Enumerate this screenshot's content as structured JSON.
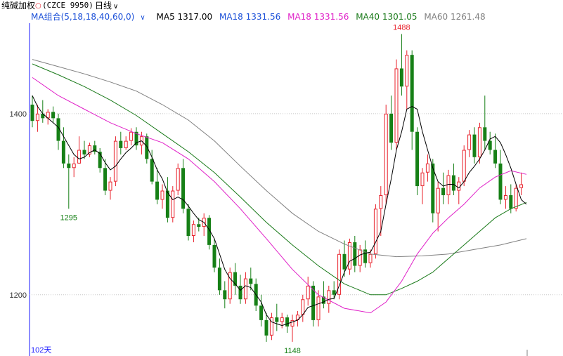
{
  "header": {
    "instrument": "纯碱加权",
    "code": "(CZCE 9950)",
    "period": "日线"
  },
  "ma_bar": {
    "group_label": "MA组合(5,18,18,40,60,0)",
    "ma5": "MA5 1317.00",
    "ma18a": "MA18 1331.56",
    "ma18b": "MA18 1331.56",
    "ma40": "MA40 1301.05",
    "ma60": "MA60 1261.48"
  },
  "colors": {
    "up": "#e8202a",
    "down": "#168016",
    "ma5": "#000000",
    "ma18": "#e020c8",
    "ma40": "#1a7a1a",
    "ma60": "#808080",
    "grid": "#c8c8c8",
    "axis": "#1a1aff"
  },
  "footer": {
    "days": "102天"
  },
  "chart_data": {
    "type": "candlestick",
    "y_ticks": [
      1400,
      1200
    ],
    "ylim": [
      1144,
      1500
    ],
    "annotations": [
      {
        "label": "1488",
        "index": 71,
        "value": 1488,
        "color": "up"
      },
      {
        "label": "1295",
        "index": 7,
        "value": 1295,
        "color": "down"
      },
      {
        "label": "1148",
        "index": 50,
        "value": 1148,
        "color": "down"
      }
    ],
    "candles": [
      [
        1410,
        1420,
        1385,
        1392
      ],
      [
        1392,
        1410,
        1380,
        1400
      ],
      [
        1400,
        1415,
        1390,
        1395
      ],
      [
        1395,
        1405,
        1388,
        1402
      ],
      [
        1402,
        1408,
        1390,
        1395
      ],
      [
        1395,
        1400,
        1360,
        1370
      ],
      [
        1370,
        1385,
        1340,
        1345
      ],
      [
        1345,
        1355,
        1295,
        1340
      ],
      [
        1340,
        1352,
        1330,
        1345
      ],
      [
        1345,
        1375,
        1345,
        1360
      ],
      [
        1360,
        1370,
        1350,
        1355
      ],
      [
        1355,
        1368,
        1352,
        1365
      ],
      [
        1365,
        1370,
        1355,
        1358
      ],
      [
        1358,
        1362,
        1335,
        1340
      ],
      [
        1340,
        1350,
        1310,
        1315
      ],
      [
        1315,
        1330,
        1305,
        1325
      ],
      [
        1325,
        1375,
        1320,
        1370
      ],
      [
        1370,
        1380,
        1355,
        1362
      ],
      [
        1362,
        1375,
        1360,
        1370
      ],
      [
        1370,
        1384,
        1365,
        1380
      ],
      [
        1380,
        1385,
        1360,
        1365
      ],
      [
        1365,
        1380,
        1355,
        1375
      ],
      [
        1375,
        1378,
        1345,
        1350
      ],
      [
        1350,
        1360,
        1322,
        1325
      ],
      [
        1325,
        1340,
        1300,
        1305
      ],
      [
        1305,
        1322,
        1295,
        1315
      ],
      [
        1315,
        1330,
        1280,
        1285
      ],
      [
        1285,
        1320,
        1280,
        1315
      ],
      [
        1315,
        1345,
        1310,
        1340
      ],
      [
        1340,
        1350,
        1290,
        1295
      ],
      [
        1295,
        1300,
        1260,
        1265
      ],
      [
        1265,
        1282,
        1258,
        1278
      ],
      [
        1278,
        1285,
        1270,
        1275
      ],
      [
        1275,
        1290,
        1265,
        1285
      ],
      [
        1285,
        1288,
        1250,
        1255
      ],
      [
        1255,
        1262,
        1225,
        1230
      ],
      [
        1230,
        1240,
        1200,
        1205
      ],
      [
        1205,
        1215,
        1185,
        1195
      ],
      [
        1195,
        1230,
        1190,
        1225
      ],
      [
        1225,
        1235,
        1200,
        1210
      ],
      [
        1210,
        1222,
        1190,
        1195
      ],
      [
        1195,
        1225,
        1190,
        1218
      ],
      [
        1218,
        1230,
        1205,
        1212
      ],
      [
        1212,
        1218,
        1182,
        1188
      ],
      [
        1188,
        1200,
        1165,
        1172
      ],
      [
        1172,
        1180,
        1148,
        1155
      ],
      [
        1155,
        1180,
        1150,
        1175
      ],
      [
        1175,
        1190,
        1160,
        1170
      ],
      [
        1170,
        1180,
        1163,
        1175
      ],
      [
        1175,
        1178,
        1158,
        1165
      ],
      [
        1165,
        1178,
        1148,
        1172
      ],
      [
        1172,
        1182,
        1165,
        1178
      ],
      [
        1178,
        1200,
        1170,
        1195
      ],
      [
        1195,
        1220,
        1188,
        1210
      ],
      [
        1210,
        1215,
        1165,
        1172
      ],
      [
        1172,
        1205,
        1165,
        1198
      ],
      [
        1198,
        1215,
        1185,
        1190
      ],
      [
        1190,
        1210,
        1180,
        1205
      ],
      [
        1205,
        1215,
        1195,
        1200
      ],
      [
        1200,
        1250,
        1195,
        1245
      ],
      [
        1245,
        1260,
        1220,
        1228
      ],
      [
        1228,
        1262,
        1222,
        1258
      ],
      [
        1258,
        1265,
        1225,
        1232
      ],
      [
        1232,
        1255,
        1225,
        1250
      ],
      [
        1250,
        1260,
        1230,
        1235
      ],
      [
        1235,
        1250,
        1230,
        1245
      ],
      [
        1245,
        1300,
        1240,
        1295
      ],
      [
        1295,
        1320,
        1265,
        1310
      ],
      [
        1310,
        1410,
        1300,
        1400
      ],
      [
        1400,
        1420,
        1360,
        1368
      ],
      [
        1368,
        1460,
        1360,
        1450
      ],
      [
        1450,
        1488,
        1420,
        1430
      ],
      [
        1430,
        1470,
        1405,
        1465
      ],
      [
        1465,
        1470,
        1360,
        1380
      ],
      [
        1380,
        1385,
        1310,
        1320
      ],
      [
        1320,
        1340,
        1300,
        1335
      ],
      [
        1335,
        1355,
        1325,
        1345
      ],
      [
        1345,
        1350,
        1280,
        1290
      ],
      [
        1290,
        1325,
        1270,
        1318
      ],
      [
        1318,
        1335,
        1300,
        1310
      ],
      [
        1310,
        1338,
        1300,
        1332
      ],
      [
        1332,
        1345,
        1310,
        1315
      ],
      [
        1315,
        1330,
        1300,
        1325
      ],
      [
        1325,
        1365,
        1320,
        1360
      ],
      [
        1360,
        1382,
        1352,
        1377
      ],
      [
        1377,
        1385,
        1345,
        1352
      ],
      [
        1352,
        1390,
        1345,
        1385
      ],
      [
        1385,
        1420,
        1360,
        1370
      ],
      [
        1370,
        1380,
        1355,
        1360
      ],
      [
        1360,
        1378,
        1340,
        1345
      ],
      [
        1345,
        1360,
        1300,
        1305
      ],
      [
        1305,
        1320,
        1295,
        1310
      ],
      [
        1310,
        1322,
        1290,
        1295
      ],
      [
        1295,
        1322,
        1292,
        1318
      ],
      [
        1318,
        1335,
        1310,
        1322
      ]
    ],
    "ma5": [
      [
        0,
        1420
      ],
      [
        1,
        1408
      ],
      [
        2,
        1400
      ],
      [
        3,
        1395
      ],
      [
        4,
        1390
      ],
      [
        5,
        1385
      ],
      [
        6,
        1375
      ],
      [
        7,
        1365
      ],
      [
        8,
        1355
      ],
      [
        9,
        1350
      ],
      [
        10,
        1352
      ],
      [
        11,
        1357
      ],
      [
        12,
        1360
      ],
      [
        13,
        1356
      ],
      [
        14,
        1346
      ],
      [
        15,
        1338
      ],
      [
        16,
        1342
      ],
      [
        17,
        1350
      ],
      [
        18,
        1357
      ],
      [
        19,
        1362
      ],
      [
        20,
        1368
      ],
      [
        21,
        1370
      ],
      [
        22,
        1364
      ],
      [
        23,
        1352
      ],
      [
        24,
        1338
      ],
      [
        25,
        1328
      ],
      [
        26,
        1313
      ],
      [
        27,
        1305
      ],
      [
        28,
        1308
      ],
      [
        29,
        1305
      ],
      [
        30,
        1298
      ],
      [
        31,
        1290
      ],
      [
        32,
        1283
      ],
      [
        33,
        1280
      ],
      [
        34,
        1272
      ],
      [
        35,
        1262
      ],
      [
        36,
        1245
      ],
      [
        37,
        1228
      ],
      [
        38,
        1218
      ],
      [
        39,
        1212
      ],
      [
        40,
        1205
      ],
      [
        41,
        1210
      ],
      [
        42,
        1208
      ],
      [
        43,
        1200
      ],
      [
        44,
        1192
      ],
      [
        45,
        1178
      ],
      [
        46,
        1170
      ],
      [
        47,
        1168
      ],
      [
        48,
        1166
      ],
      [
        49,
        1168
      ],
      [
        50,
        1170
      ],
      [
        51,
        1172
      ],
      [
        52,
        1178
      ],
      [
        53,
        1186
      ],
      [
        54,
        1188
      ],
      [
        55,
        1190
      ],
      [
        56,
        1192
      ],
      [
        57,
        1195
      ],
      [
        58,
        1196
      ],
      [
        59,
        1210
      ],
      [
        60,
        1225
      ],
      [
        61,
        1237
      ],
      [
        62,
        1240
      ],
      [
        63,
        1244
      ],
      [
        64,
        1246
      ],
      [
        65,
        1247
      ],
      [
        66,
        1258
      ],
      [
        67,
        1270
      ],
      [
        68,
        1300
      ],
      [
        69,
        1328
      ],
      [
        70,
        1360
      ],
      [
        71,
        1380
      ],
      [
        72,
        1405
      ],
      [
        73,
        1408
      ],
      [
        74,
        1405
      ],
      [
        75,
        1380
      ],
      [
        76,
        1360
      ],
      [
        77,
        1340
      ],
      [
        78,
        1325
      ],
      [
        79,
        1320
      ],
      [
        80,
        1322
      ],
      [
        81,
        1322
      ],
      [
        82,
        1318
      ],
      [
        83,
        1325
      ],
      [
        84,
        1335
      ],
      [
        85,
        1342
      ],
      [
        86,
        1350
      ],
      [
        87,
        1360
      ],
      [
        88,
        1372
      ],
      [
        89,
        1375
      ],
      [
        90,
        1368
      ],
      [
        91,
        1355
      ],
      [
        92,
        1340
      ],
      [
        93,
        1322
      ],
      [
        94,
        1305
      ],
      [
        95,
        1300
      ]
    ],
    "ma18": [
      [
        0,
        1440
      ],
      [
        5,
        1420
      ],
      [
        10,
        1405
      ],
      [
        15,
        1390
      ],
      [
        20,
        1378
      ],
      [
        25,
        1368
      ],
      [
        30,
        1350
      ],
      [
        35,
        1325
      ],
      [
        40,
        1295
      ],
      [
        45,
        1262
      ],
      [
        50,
        1228
      ],
      [
        55,
        1200
      ],
      [
        60,
        1185
      ],
      [
        65,
        1180
      ],
      [
        68,
        1192
      ],
      [
        71,
        1215
      ],
      [
        74,
        1245
      ],
      [
        77,
        1268
      ],
      [
        80,
        1285
      ],
      [
        83,
        1300
      ],
      [
        86,
        1318
      ],
      [
        89,
        1330
      ],
      [
        92,
        1337
      ],
      [
        95,
        1333
      ]
    ],
    "ma40": [
      [
        0,
        1455
      ],
      [
        5,
        1443
      ],
      [
        10,
        1430
      ],
      [
        15,
        1415
      ],
      [
        20,
        1398
      ],
      [
        25,
        1378
      ],
      [
        30,
        1358
      ],
      [
        35,
        1335
      ],
      [
        40,
        1308
      ],
      [
        45,
        1280
      ],
      [
        50,
        1255
      ],
      [
        55,
        1232
      ],
      [
        60,
        1212
      ],
      [
        65,
        1200
      ],
      [
        68,
        1200
      ],
      [
        71,
        1207
      ],
      [
        74,
        1215
      ],
      [
        77,
        1225
      ],
      [
        80,
        1240
      ],
      [
        83,
        1255
      ],
      [
        86,
        1270
      ],
      [
        89,
        1285
      ],
      [
        92,
        1295
      ],
      [
        95,
        1302
      ]
    ],
    "ma60": [
      [
        0,
        1460
      ],
      [
        5,
        1452
      ],
      [
        10,
        1444
      ],
      [
        15,
        1435
      ],
      [
        20,
        1425
      ],
      [
        25,
        1410
      ],
      [
        30,
        1393
      ],
      [
        35,
        1370
      ],
      [
        40,
        1342
      ],
      [
        45,
        1315
      ],
      [
        50,
        1290
      ],
      [
        55,
        1270
      ],
      [
        60,
        1256
      ],
      [
        65,
        1245
      ],
      [
        70,
        1242
      ],
      [
        75,
        1243
      ],
      [
        80,
        1245
      ],
      [
        85,
        1250
      ],
      [
        90,
        1255
      ],
      [
        95,
        1262
      ]
    ]
  }
}
